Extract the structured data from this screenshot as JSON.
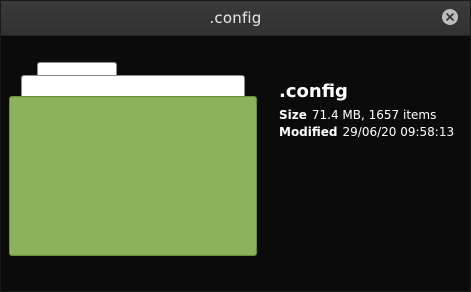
{
  "window": {
    "title": ".config"
  },
  "icons": {
    "close": "close-icon",
    "folder": "folder-icon"
  },
  "colors": {
    "folder_front": "#8db25c",
    "titlebar": "#353535",
    "background": "#0b0b0b"
  },
  "info": {
    "name": ".config",
    "size_label": "Size",
    "size_value": "71.4 MB, 1657 items",
    "modified_label": "Modified",
    "modified_value": "29/06/20 09:58:13"
  }
}
